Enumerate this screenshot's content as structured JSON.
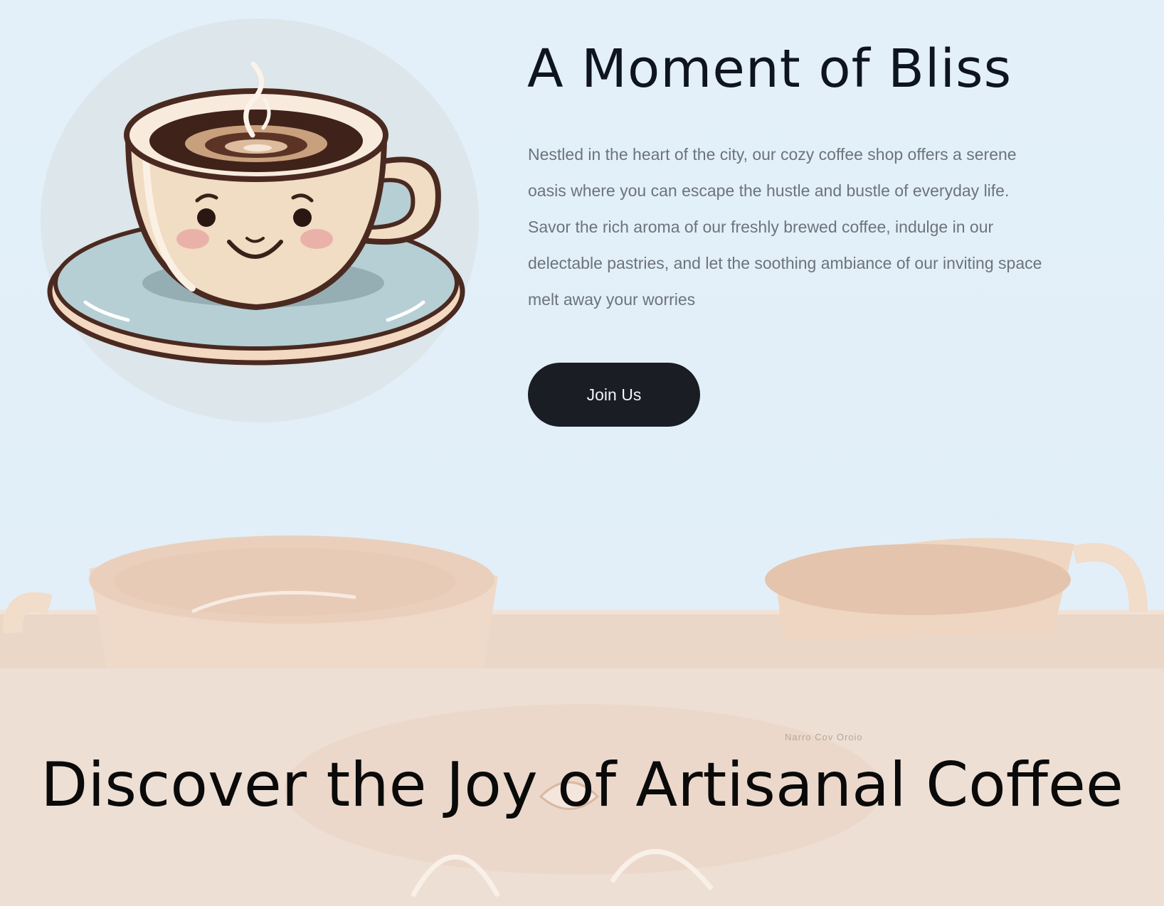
{
  "hero": {
    "title": "A Moment of Bliss",
    "description": "Nestled in the heart of the city, our cozy coffee shop offers a serene oasis where you can escape the hustle and bustle of everyday life. Savor the rich aroma of our freshly brewed coffee, indulge in our delectable pastries, and let the soothing ambiance of our inviting space melt away your worries",
    "cta_label": "Join Us",
    "illustration_icon": "smiling-coffee-cup-icon"
  },
  "discover": {
    "title": "Discover the Joy of Artisanal Coffee",
    "background_note": "Narro Cov Oroio"
  },
  "colors": {
    "hero_background": "#e3f0fa",
    "button_background": "#1a1d24",
    "button_text": "#f3f4f6",
    "title_text": "#0e1420",
    "body_text": "#6d737b",
    "discover_background": "#eddfd4"
  }
}
